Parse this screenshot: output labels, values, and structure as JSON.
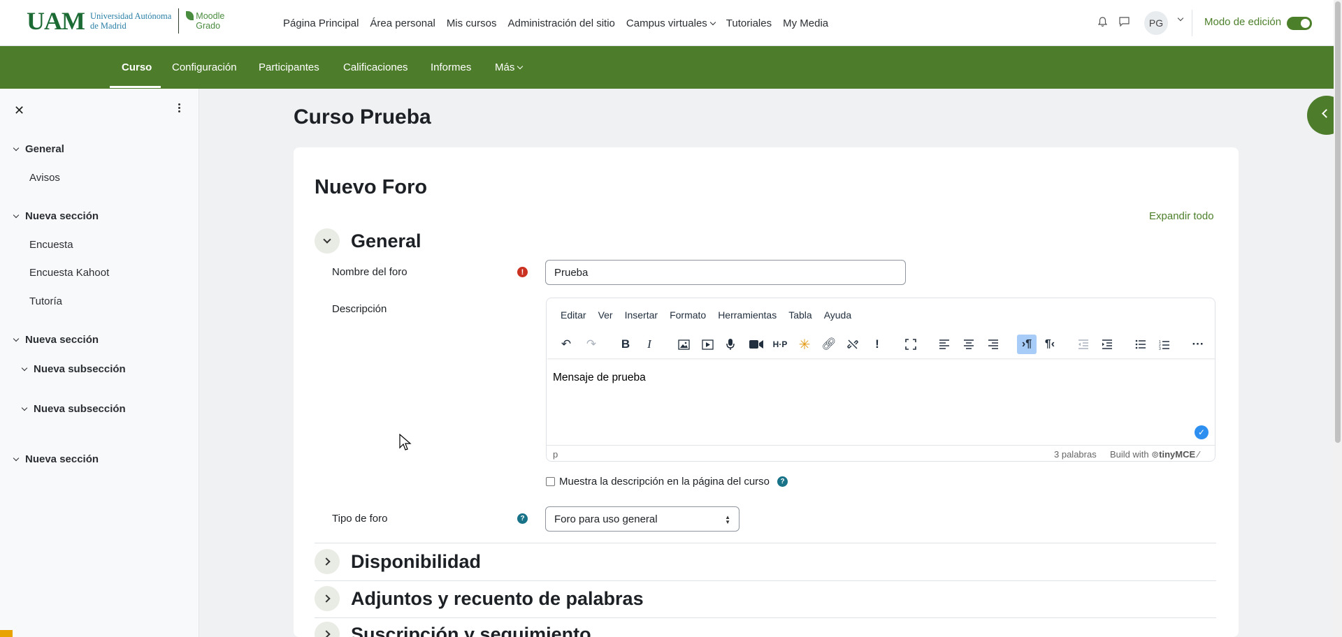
{
  "logo": {
    "uam": "UAM",
    "university_line1": "Universidad Autónoma",
    "university_line2": "de Madrid",
    "moodle_line1": "Moodle",
    "moodle_line2": "Grado"
  },
  "topnav": {
    "items": [
      "Página Principal",
      "Área personal",
      "Mis cursos",
      "Administración del sitio",
      "Campus virtuales",
      "Tutoriales",
      "My Media"
    ],
    "avatar_initials": "PG",
    "edit_mode_label": "Modo de edición",
    "edit_mode_on": true
  },
  "secnav": {
    "items": [
      "Curso",
      "Configuración",
      "Participantes",
      "Calificaciones",
      "Informes",
      "Más"
    ],
    "active": "Curso"
  },
  "sidebar": {
    "items": [
      {
        "label": "General",
        "type": "section"
      },
      {
        "label": "Avisos",
        "type": "activity"
      },
      {
        "label": "Nueva sección",
        "type": "section"
      },
      {
        "label": "Encuesta",
        "type": "activity"
      },
      {
        "label": "Encuesta Kahoot",
        "type": "activity"
      },
      {
        "label": "Tutoría",
        "type": "activity"
      },
      {
        "label": "Nueva sección",
        "type": "section"
      },
      {
        "label": "Nueva subsección",
        "type": "subsection"
      },
      {
        "label": "Nueva subsección",
        "type": "subsection"
      },
      {
        "label": "Nueva sección",
        "type": "section"
      }
    ]
  },
  "page": {
    "course_title": "Curso Prueba",
    "heading": "Nuevo Foro",
    "expand_all": "Expandir todo"
  },
  "form": {
    "general_section": "General",
    "forum_name_label": "Nombre del foro",
    "forum_name_value": "Prueba",
    "description_label": "Descripción",
    "editor": {
      "menu": [
        "Editar",
        "Ver",
        "Insertar",
        "Formato",
        "Herramientas",
        "Tabla",
        "Ayuda"
      ],
      "content": "Mensaje de prueba",
      "path": "p",
      "word_count": "3 palabras",
      "build_with": "Build with",
      "brand": "tinyMCE"
    },
    "show_description_label": "Muestra la descripción en la página del curso",
    "show_description_checked": false,
    "forum_type_label": "Tipo de foro",
    "forum_type_value": "Foro para uso general"
  },
  "collapsed_sections": [
    "Disponibilidad",
    "Adjuntos y recuento de palabras",
    "Suscripción y seguimiento"
  ],
  "colors": {
    "brand_green": "#4d7d2b",
    "required": "#ca3120",
    "help": "#187288"
  }
}
